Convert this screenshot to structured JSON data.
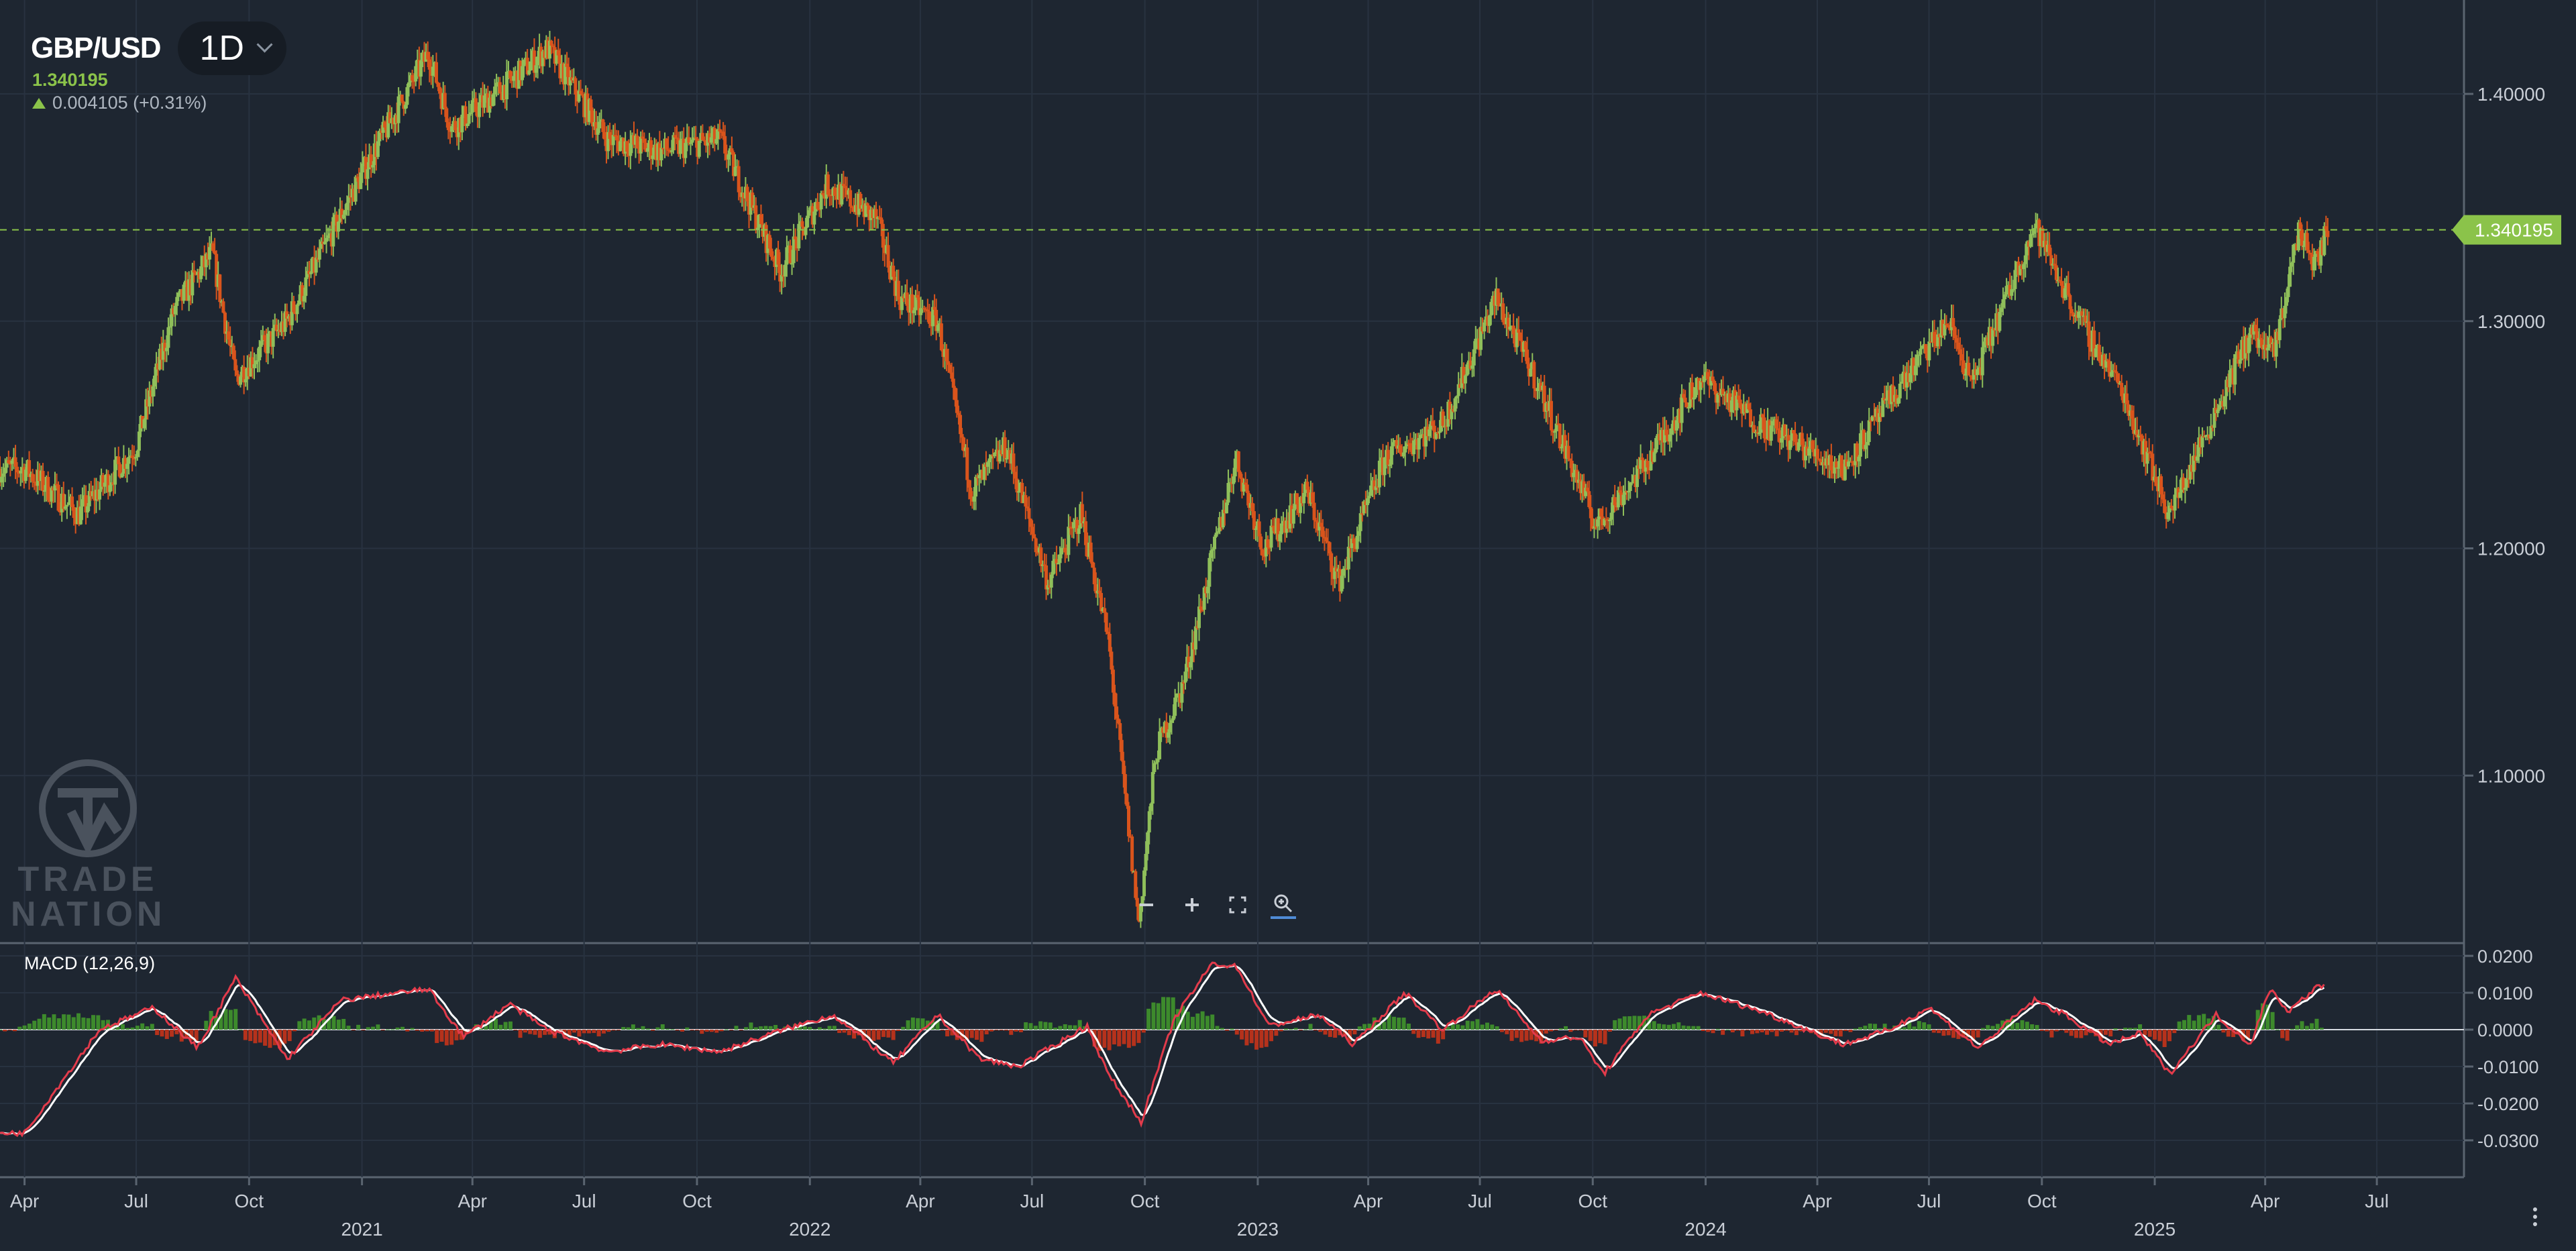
{
  "header": {
    "symbol": "GBP/USD",
    "timeframe": "1D",
    "price": "1.340195",
    "change": "0.004105 (+0.31%)"
  },
  "macd": {
    "label": "MACD (12,26,9)"
  },
  "price_tag": "1.340195",
  "logo": {
    "line1": "TRADE",
    "line2": "NATION"
  },
  "zoom_controls": [
    "zoom-out",
    "zoom-in",
    "fit-screen",
    "zoom-search"
  ],
  "colors": {
    "background": "#1e2631",
    "up": "#8fbf5a",
    "down": "#d9541c",
    "macd": "#e23b4b",
    "signal": "#ffffff",
    "tag": "#8bc34a"
  },
  "chart_data": [
    {
      "type": "candlestick",
      "series": [
        {
          "name": "GBP/USD",
          "x": [
            "2020-04-01",
            "2020-05-15",
            "2020-07-01",
            "2020-08-01",
            "2020-09-01",
            "2020-09-20",
            "2020-11-01",
            "2021-01-01",
            "2021-02-24",
            "2021-03-15",
            "2021-05-01",
            "2021-06-01",
            "2021-07-20",
            "2021-09-01",
            "2021-10-20",
            "2021-12-08",
            "2022-01-15",
            "2022-02-24",
            "2022-03-15",
            "2022-04-15",
            "2022-05-13",
            "2022-06-10",
            "2022-07-14",
            "2022-08-10",
            "2022-09-01",
            "2022-09-26",
            "2022-10-10",
            "2022-11-01",
            "2022-12-14",
            "2023-01-06",
            "2023-02-10",
            "2023-03-08",
            "2023-04-15",
            "2023-06-01",
            "2023-07-14",
            "2023-08-15",
            "2023-10-04",
            "2023-11-10",
            "2023-12-28",
            "2024-02-14",
            "2024-04-22",
            "2024-06-12",
            "2024-07-17",
            "2024-08-05",
            "2024-09-25",
            "2024-11-01",
            "2024-12-05",
            "2025-01-13",
            "2025-02-15",
            "2025-03-20",
            "2025-04-08",
            "2025-04-28",
            "2025-05-12",
            "2025-05-22"
          ],
          "y": [
            1.235,
            1.215,
            1.245,
            1.305,
            1.33,
            1.275,
            1.3,
            1.365,
            1.418,
            1.385,
            1.405,
            1.42,
            1.38,
            1.375,
            1.38,
            1.322,
            1.36,
            1.345,
            1.31,
            1.3,
            1.225,
            1.245,
            1.185,
            1.215,
            1.16,
            1.035,
            1.11,
            1.14,
            1.24,
            1.2,
            1.225,
            1.185,
            1.24,
            1.255,
            1.31,
            1.275,
            1.21,
            1.235,
            1.275,
            1.255,
            1.235,
            1.275,
            1.3,
            1.272,
            1.342,
            1.3,
            1.27,
            1.215,
            1.255,
            1.295,
            1.285,
            1.34,
            1.325,
            1.34
          ]
        }
      ],
      "ylim": [
        1.02,
        1.44
      ],
      "yticks": [
        "1.40000",
        "1.30000",
        "1.20000",
        "1.10000"
      ],
      "xticks": [
        "Apr",
        "Jul",
        "Oct",
        "2021",
        "Apr",
        "Jul",
        "Oct",
        "2022",
        "Apr",
        "Jul",
        "Oct",
        "2023",
        "Apr",
        "Jul",
        "Oct",
        "2024",
        "Apr",
        "Jul",
        "Oct",
        "2025",
        "Apr",
        "Jul"
      ],
      "xticks_major": [
        "2021",
        "2022",
        "2023",
        "2024",
        "2025"
      ],
      "reference_line": 1.340195,
      "grid": true
    },
    {
      "type": "line",
      "title": "MACD (12,26,9)",
      "series": [
        {
          "name": "MACD",
          "x": [
            "2020-04-01",
            "2020-06-01",
            "2020-07-15",
            "2020-08-20",
            "2020-09-20",
            "2020-11-01",
            "2020-12-15",
            "2021-02-24",
            "2021-03-25",
            "2021-05-01",
            "2021-06-01",
            "2021-07-20",
            "2021-09-01",
            "2021-10-20",
            "2021-12-10",
            "2022-01-20",
            "2022-03-10",
            "2022-04-15",
            "2022-05-20",
            "2022-06-20",
            "2022-07-20",
            "2022-08-15",
            "2022-09-01",
            "2022-09-28",
            "2022-10-25",
            "2022-11-25",
            "2022-12-15",
            "2023-01-10",
            "2023-02-20",
            "2023-03-20",
            "2023-05-01",
            "2023-06-01",
            "2023-07-14",
            "2023-08-20",
            "2023-09-20",
            "2023-10-10",
            "2023-11-15",
            "2023-12-28",
            "2024-02-15",
            "2024-04-22",
            "2024-05-30",
            "2024-07-01",
            "2024-08-10",
            "2024-09-25",
            "2024-10-20",
            "2024-11-25",
            "2024-12-20",
            "2025-01-13",
            "2025-02-20",
            "2025-03-20",
            "2025-04-05",
            "2025-04-20",
            "2025-05-15"
          ],
          "y": [
            -0.028,
            0.0,
            0.006,
            -0.005,
            0.014,
            -0.008,
            0.008,
            0.011,
            -0.002,
            0.007,
            0.0,
            -0.006,
            -0.004,
            -0.006,
            0.0,
            0.004,
            -0.009,
            0.004,
            -0.008,
            -0.01,
            -0.004,
            0.001,
            -0.012,
            -0.025,
            0.003,
            0.018,
            0.017,
            0.001,
            0.004,
            -0.004,
            0.01,
            0.0,
            0.011,
            -0.003,
            -0.002,
            -0.012,
            0.004,
            0.01,
            0.005,
            -0.004,
            0.0,
            0.006,
            -0.005,
            0.008,
            0.004,
            -0.004,
            -0.001,
            -0.012,
            0.004,
            -0.004,
            0.011,
            0.005,
            0.012
          ]
        }
      ],
      "ylim": [
        -0.04,
        0.02
      ],
      "yticks": [
        "0.0200",
        "0.0100",
        "0.0000",
        "-0.0100",
        "-0.0200",
        "-0.0300"
      ],
      "reference_line": 0
    }
  ]
}
